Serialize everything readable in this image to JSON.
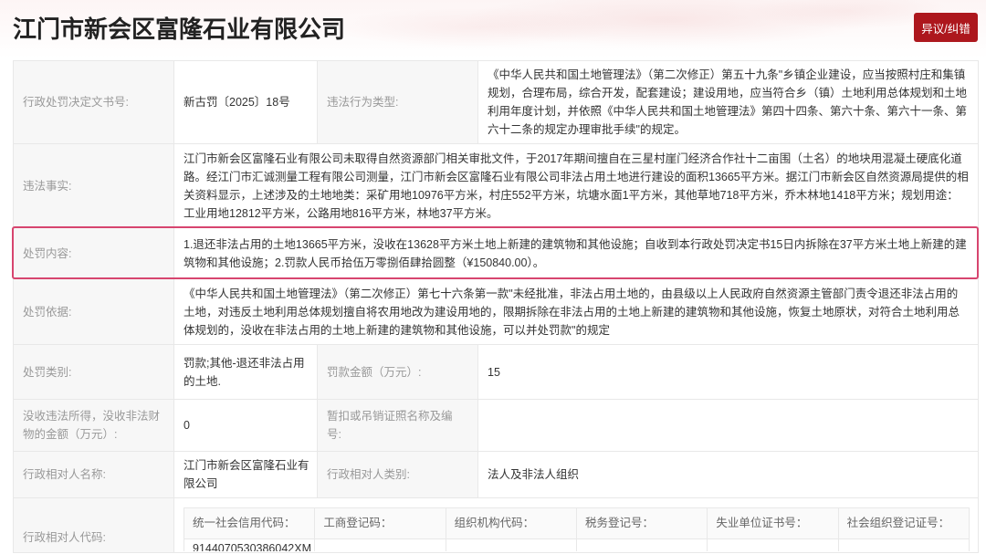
{
  "header": {
    "title": "江门市新会区富隆石业有限公司",
    "feedback_button": "异议/纠错"
  },
  "record": {
    "decision_no": {
      "label": "行政处罚决定文书号:",
      "value": "新古罚〔2025〕18号"
    },
    "violation_type": {
      "label": "违法行为类型:",
      "value": "《中华人民共和国土地管理法》（第二次修正）第五十九条\"乡镇企业建设，应当按照村庄和集镇规划，合理布局，综合开发，配套建设；建设用地，应当符合乡（镇）土地利用总体规划和土地利用年度计划，并依照《中华人民共和国土地管理法》第四十四条、第六十条、第六十一条、第六十二条的规定办理审批手续\"的规定。"
    },
    "violation_facts": {
      "label": "违法事实:",
      "value": "江门市新会区富隆石业有限公司未取得自然资源部门相关审批文件，于2017年期间擅自在三星村崖门经济合作社十二亩围（土名）的地块用混凝土硬底化道路。经江门市汇诚测量工程有限公司测量，江门市新会区富隆石业有限公司非法占用土地进行建设的面积13665平方米。据江门市新会区自然资源局提供的相关资料显示，上述涉及的土地地类：采矿用地10976平方米，村庄552平方米，坑塘水面1平方米，其他草地718平方米，乔木林地1418平方米；规划用途：工业用地12812平方米，公路用地816平方米，林地37平方米。"
    },
    "penalty_content": {
      "label": "处罚内容:",
      "value": "1.退还非法占用的土地13665平方米，没收在13628平方米土地上新建的建筑物和其他设施；自收到本行政处罚决定书15日内拆除在37平方米土地上新建的建筑物和其他设施；2.罚款人民币拾伍万零捌佰肆拾圆整（¥150840.00）。"
    },
    "penalty_basis": {
      "label": "处罚依据:",
      "value": "《中华人民共和国土地管理法》（第二次修正）第七十六条第一款\"未经批准，非法占用土地的，由县级以上人民政府自然资源主管部门责令退还非法占用的土地，对违反土地利用总体规划擅自将农用地改为建设用地的，限期拆除在非法占用的土地上新建的建筑物和其他设施，恢复土地原状，对符合土地利用总体规划的，没收在非法占用的土地上新建的建筑物和其他设施，可以并处罚款\"的规定"
    },
    "penalty_category": {
      "label": "处罚类别:",
      "value": "罚款;其他-退还非法占用的土地."
    },
    "fine_amount": {
      "label": "罚款金额（万元）:",
      "value": "15"
    },
    "confiscation_amount": {
      "label": "没收违法所得，没收非法财物的金额（万元）:",
      "value": "0"
    },
    "license_revoked": {
      "label": "暂扣或吊销证照名称及编号:"
    },
    "party_name": {
      "label": "行政相对人名称:",
      "value": "江门市新会区富隆石业有限公司"
    },
    "party_type": {
      "label": "行政相对人类别:",
      "value": "法人及非法人组织"
    },
    "party_code": {
      "label": "行政相对人代码:",
      "columns": [
        "统一社会信用代码：",
        "工商登记码：",
        "组织机构代码：",
        "税务登记号：",
        "失业单位证书号：",
        "社会组织登记证号："
      ],
      "values": [
        "9144070530386042XM"
      ]
    }
  },
  "colors": {
    "accent": "#ad171d",
    "highlight": "#d7456f",
    "label_text": "#999999",
    "value_text": "#333333"
  }
}
